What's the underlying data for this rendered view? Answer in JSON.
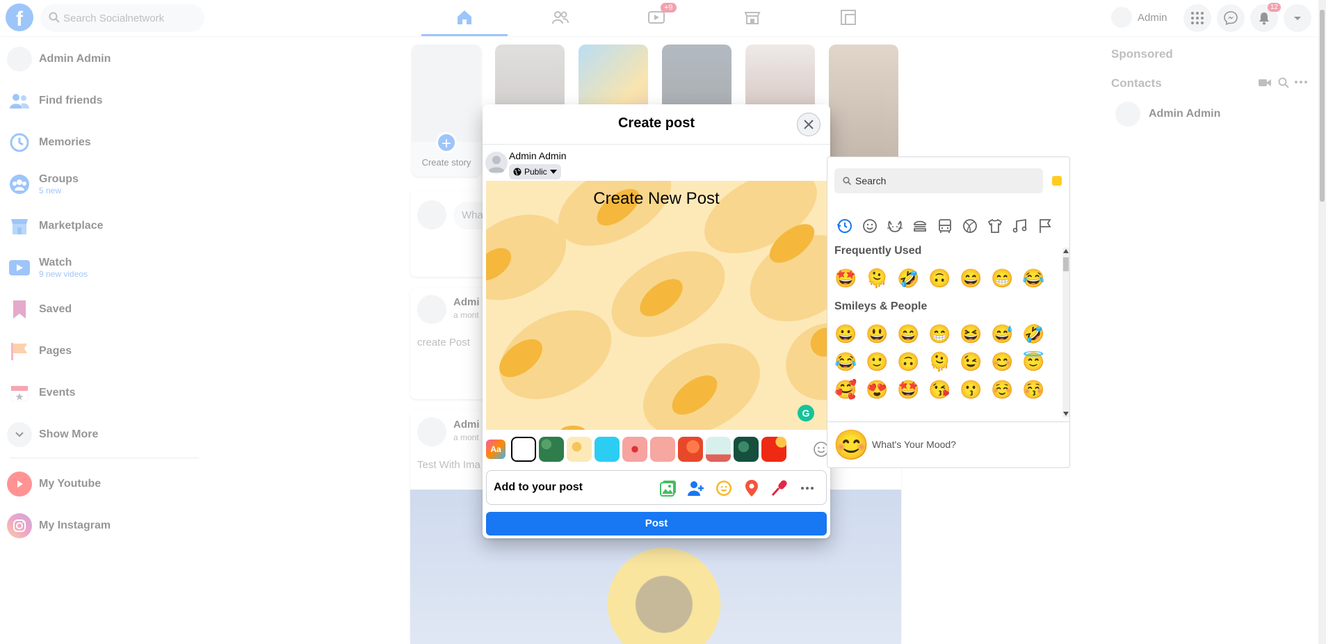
{
  "topbar": {
    "search_placeholder": "Search Socialnetwork",
    "user_name": "Admin",
    "watch_badge": "+9",
    "notif_badge": "12"
  },
  "left_nav": {
    "items": [
      {
        "label": "Admin Admin",
        "sub": ""
      },
      {
        "label": "Find friends",
        "sub": ""
      },
      {
        "label": "Memories",
        "sub": ""
      },
      {
        "label": "Groups",
        "sub": "5 new"
      },
      {
        "label": "Marketplace",
        "sub": ""
      },
      {
        "label": "Watch",
        "sub": "9 new videos"
      },
      {
        "label": "Saved",
        "sub": ""
      },
      {
        "label": "Pages",
        "sub": ""
      },
      {
        "label": "Events",
        "sub": ""
      },
      {
        "label": "Show More",
        "sub": ""
      },
      {
        "label": "My Youtube",
        "sub": ""
      },
      {
        "label": "My Instagram",
        "sub": ""
      }
    ]
  },
  "stories": {
    "create_label": "Create story"
  },
  "composer": {
    "placeholder": "What"
  },
  "feed": {
    "posts": [
      {
        "name": "Admi",
        "time": "a mont",
        "text": "create Post"
      },
      {
        "name": "Admi",
        "time": "a mont",
        "text": "Test With Ima"
      }
    ]
  },
  "right": {
    "sponsored": "Sponsored",
    "contacts": "Contacts",
    "contact_name": "Admin Admin"
  },
  "modal": {
    "title": "Create post",
    "author": "Admin Admin",
    "privacy": "Public",
    "canvas_text": "Create New Post",
    "add_to_post": "Add to your post",
    "post_button": "Post",
    "bg_aa": "Aa",
    "grammarly": "G"
  },
  "picker": {
    "search_placeholder": "Search",
    "sections": [
      {
        "title": "Frequently Used",
        "emojis": [
          "🤩",
          "🫠",
          "🤣",
          "🙃",
          "😄",
          "😁",
          "😂"
        ]
      },
      {
        "title": "Smileys & People",
        "emojis": [
          "😀",
          "😃",
          "😄",
          "😁",
          "😆",
          "😅",
          "🤣",
          "😂",
          "🙂",
          "🙃",
          "🫠",
          "😉",
          "😊",
          "😇",
          "🥰",
          "😍",
          "🤩",
          "😘",
          "😗",
          "☺️",
          "😚"
        ]
      }
    ],
    "mood_emoji": "😊",
    "mood_text": "What's Your Mood?"
  },
  "colors": {
    "brand": "#1877f2",
    "canvas_bg": "#fde9b8",
    "canvas_blob_light": "#f8d68e",
    "canvas_blob_dark": "#f5b83d"
  }
}
